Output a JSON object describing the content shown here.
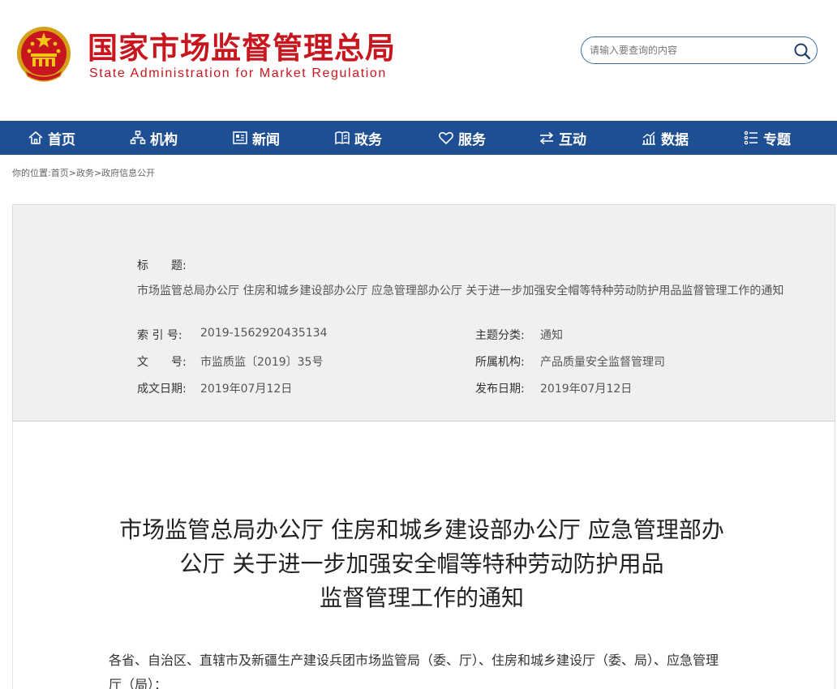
{
  "header": {
    "title_cn": "国家市场监督管理总局",
    "title_en": "State Administration for Market Regulation",
    "search_placeholder": "请输入要查询的内容"
  },
  "colors": {
    "brand_red": "#c8161e",
    "nav_blue": "#1e4f92",
    "panel_gray": "#f0f0f0"
  },
  "nav": {
    "items": [
      {
        "label": "首页",
        "icon": "home-icon"
      },
      {
        "label": "机构",
        "icon": "org-chart-icon"
      },
      {
        "label": "新闻",
        "icon": "newspaper-icon"
      },
      {
        "label": "政务",
        "icon": "book-icon"
      },
      {
        "label": "服务",
        "icon": "heart-icon"
      },
      {
        "label": "互动",
        "icon": "exchange-icon"
      },
      {
        "label": "数据",
        "icon": "chart-icon"
      },
      {
        "label": "专题",
        "icon": "list-icon"
      }
    ]
  },
  "breadcrumb": {
    "prefix": "你的位置:",
    "items": [
      "首页",
      "政务",
      "政府信息公开"
    ],
    "separator": ">"
  },
  "info": {
    "title_label": "标　　题:",
    "title_value": "市场监管总局办公厅 住房和城乡建设部办公厅 应急管理部办公厅 关于进一步加强安全帽等特种劳动防护用品监督管理工作的通知",
    "index_label": "索 引 号:",
    "index_value": "2019-1562920435134",
    "topic_label": "主题分类:",
    "topic_value": "通知",
    "docno_label": "文　　号:",
    "docno_value": "市监质监〔2019〕35号",
    "org_label": "所属机构:",
    "org_value": "产品质量安全监督管理司",
    "created_label": "成文日期:",
    "created_value": "2019年07月12日",
    "published_label": "发布日期:",
    "published_value": "2019年07月12日"
  },
  "document": {
    "heading_lines": [
      "市场监管总局办公厅 住房和城乡建设部办公厅 应急管理部办",
      "公厅 关于进一步加强安全帽等特种劳动防护用品",
      "监督管理工作的通知"
    ],
    "body_line1": "各省、自治区、直辖市及新疆生产建设兵团市场监管局（委、厅）、住房和城乡建设厅（委、局）、应急管理",
    "body_line2": "厅（局）："
  }
}
